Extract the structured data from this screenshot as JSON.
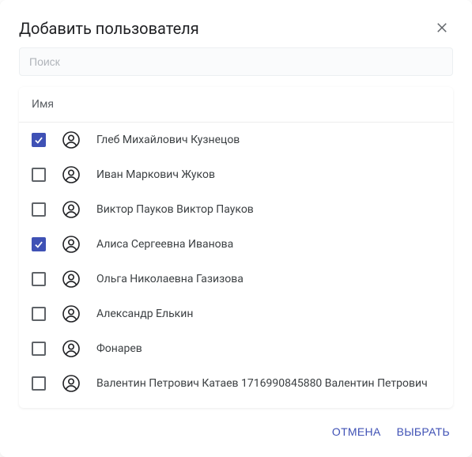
{
  "dialog": {
    "title": "Добавить пользователя"
  },
  "search": {
    "placeholder": "Поиск",
    "value": ""
  },
  "table": {
    "column_header": "Имя"
  },
  "users": [
    {
      "name": "Глеб Михайлович Кузнецов",
      "checked": true
    },
    {
      "name": "Иван Маркович Жуков",
      "checked": false
    },
    {
      "name": "Виктор Пауков Виктор Пауков",
      "checked": false
    },
    {
      "name": "Алиса Сергеевна Иванова",
      "checked": true
    },
    {
      "name": "Ольга Николаевна Газизова",
      "checked": false
    },
    {
      "name": "Александр Елькин",
      "checked": false
    },
    {
      "name": "Фонарев",
      "checked": false
    },
    {
      "name": "Валентин Петрович Катаев 1716990845880 Валентин Петрович",
      "checked": false
    }
  ],
  "footer": {
    "cancel": "ОТМЕНА",
    "select": "ВЫБРАТЬ"
  },
  "colors": {
    "accent": "#3f51b5"
  }
}
